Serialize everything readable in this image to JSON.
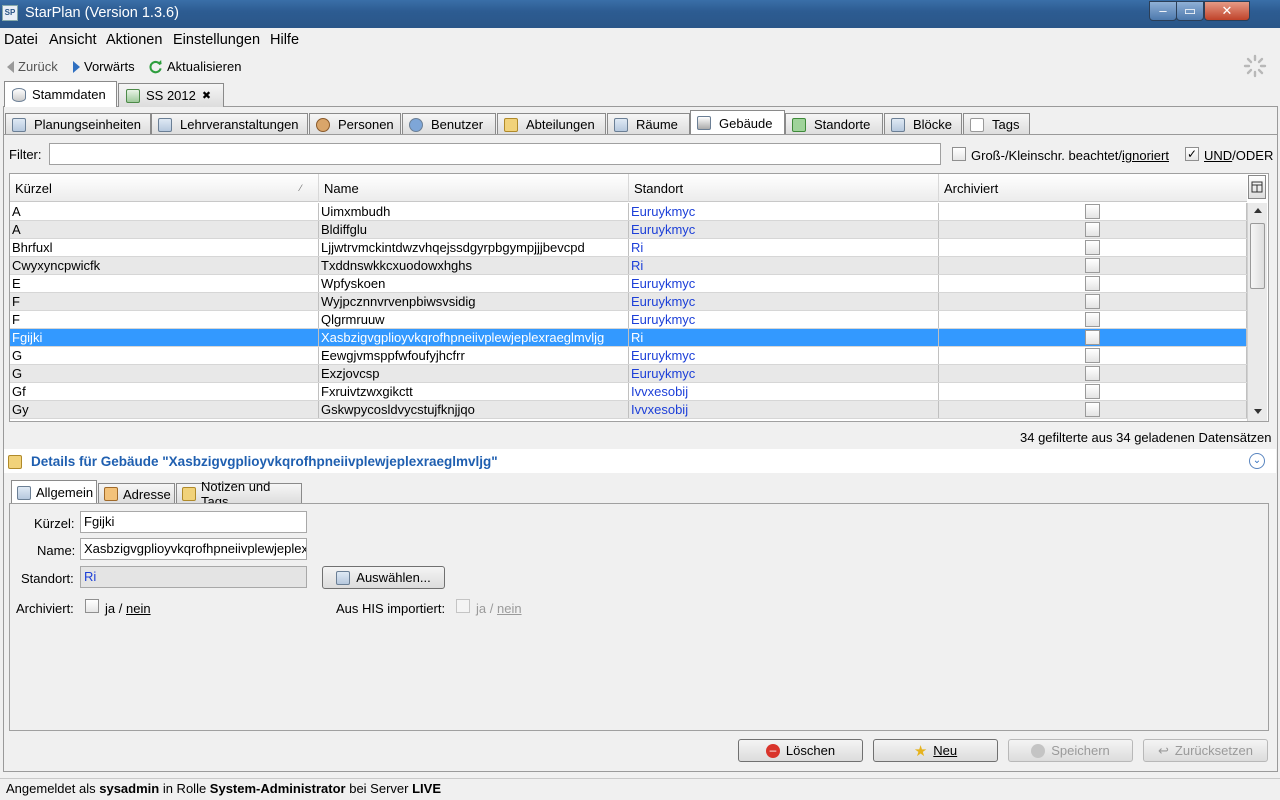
{
  "window": {
    "title": "StarPlan (Version 1.3.6)",
    "app_icon": "SP",
    "min": "–",
    "max": "▭",
    "close": "✕"
  },
  "menu": [
    "Datei",
    "Ansicht",
    "Aktionen",
    "Einstellungen",
    "Hilfe"
  ],
  "nav": {
    "back": "Zurück",
    "forward": "Vorwärts",
    "refresh": "Aktualisieren"
  },
  "top_tabs": [
    {
      "label": "Stammdaten",
      "icon": "database-icon",
      "active": true
    },
    {
      "label": "SS 2012",
      "icon": "table-icon",
      "closable": true
    }
  ],
  "close_glyph": "✖",
  "sub_tabs": [
    "Planungseinheiten",
    "Lehrveranstaltungen",
    "Personen",
    "Benutzer",
    "Abteilungen",
    "Räume",
    "Gebäude",
    "Standorte",
    "Blöcke",
    "Tags"
  ],
  "active_sub_tab": "Gebäude",
  "filter": {
    "label": "Filter:",
    "value": "",
    "case_label_a": "Groß-/Kleinschr. beachtet/",
    "case_label_b": "ignoriert",
    "case_checked": false,
    "and_label_a": "UND",
    "and_label_b": "/ODER",
    "and_checked": true
  },
  "table": {
    "columns": [
      "Kürzel",
      "Name",
      "Standort",
      "Archiviert"
    ],
    "rows": [
      {
        "kuerzel": "A",
        "name": "Uimxmbudh",
        "standort": "Euruykmyc",
        "archiviert": false
      },
      {
        "kuerzel": "A",
        "name": "Bldiffglu",
        "standort": "Euruykmyc",
        "archiviert": false
      },
      {
        "kuerzel": "Bhrfuxl",
        "name": "Ljjwtrvmckintdwzvhqejssdgyrpbgympjjjbevcpd",
        "standort": "Ri",
        "archiviert": false
      },
      {
        "kuerzel": "Cwyxyncpwicfk",
        "name": "Txddnswkkcxuodowxhghs",
        "standort": "Ri",
        "archiviert": false
      },
      {
        "kuerzel": "E",
        "name": "Wpfyskoen",
        "standort": "Euruykmyc",
        "archiviert": false
      },
      {
        "kuerzel": "F",
        "name": "Wyjpcznnvrvenpbiwsvsidig",
        "standort": "Euruykmyc",
        "archiviert": false
      },
      {
        "kuerzel": "F",
        "name": "Qlgrmruuw",
        "standort": "Euruykmyc",
        "archiviert": false
      },
      {
        "kuerzel": "Fgijki",
        "name": "Xasbzigvgplioyvkqrofhpneiivplewjeplexraeglmvljg",
        "standort": "Ri",
        "archiviert": false,
        "selected": true
      },
      {
        "kuerzel": "G",
        "name": "Eewgjvmsppfwfoufyjhcfrr",
        "standort": "Euruykmyc",
        "archiviert": false
      },
      {
        "kuerzel": "G",
        "name": "Exzjovcsp",
        "standort": "Euruykmyc",
        "archiviert": false
      },
      {
        "kuerzel": "Gf",
        "name": "Fxruivtzwxgikctt",
        "standort": "Ivvxesobij",
        "archiviert": false
      },
      {
        "kuerzel": "Gy",
        "name": "Gskwpycosldvycstujfknjjqo",
        "standort": "Ivvxesobij",
        "archiviert": false
      }
    ],
    "count_text": "34 gefilterte aus 34 geladenen Datensätzen"
  },
  "details": {
    "title": "Details für Gebäude \"Xasbzigvgplioyvkqrofhpneiivplewjeplexraeglmvljg\"",
    "tabs": [
      "Allgemein",
      "Adresse",
      "Notizen und Tags"
    ],
    "fields": {
      "kuerzel_label": "Kürzel:",
      "kuerzel_value": "Fgijki",
      "name_label": "Name:",
      "name_value": "Xasbzigvgplioyvkqrofhpneiivplewjeplex",
      "standort_label": "Standort:",
      "standort_value": "Ri",
      "auswaehlen": "Auswählen...",
      "archiviert_label": "Archiviert:",
      "archiviert_ja": "ja",
      "archiviert_sep": "/",
      "archiviert_nein": "nein",
      "his_label": "Aus HIS importiert:",
      "his_ja": "ja",
      "his_sep": "/",
      "his_nein": "nein"
    }
  },
  "buttons": {
    "loeschen": "Löschen",
    "neu": "Neu",
    "speichern": "Speichern",
    "zuruecksetzen": "Zurücksetzen"
  },
  "status": {
    "p1": "Angemeldet als ",
    "user": "sysadmin",
    "p2": " in Rolle ",
    "role": "System-Administrator",
    "p3": " bei Server ",
    "server": "LIVE"
  },
  "colors": {
    "selection": "#3399ff",
    "link": "#1c3fd8",
    "detail_title": "#1f5fb0",
    "titlebar": "#2d5c92"
  }
}
